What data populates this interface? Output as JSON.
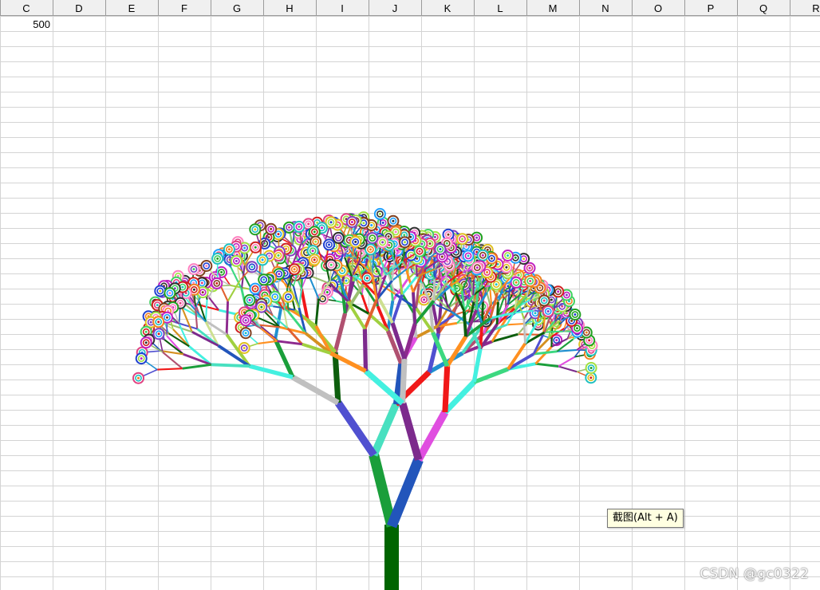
{
  "spreadsheet": {
    "column_headers": [
      "C",
      "D",
      "E",
      "F",
      "G",
      "H",
      "I",
      "J",
      "K",
      "L",
      "M",
      "N",
      "O",
      "P",
      "Q",
      "R"
    ],
    "cells": [
      {
        "column": "C",
        "row": 1,
        "value": "500"
      }
    ]
  },
  "tooltip": {
    "text": "截图(Alt + A)"
  },
  "watermark": {
    "text": "CSDN @gc0322"
  },
  "drawing": {
    "description_name": "fractal-tree",
    "trunk_color": "#006400",
    "branch_palette": [
      "#1a9e3a",
      "#8e2a8e",
      "#0d5e0d",
      "#e04ee0",
      "#b05070",
      "#cde090",
      "#44f0e0",
      "#2255bb",
      "#9bbf70",
      "#3cd880",
      "#c0c0c0",
      "#e06030",
      "#d59020",
      "#7c2a8c",
      "#48e0c0",
      "#f01818",
      "#2090d0",
      "#a0d040",
      "#ff9020",
      "#5050d0"
    ],
    "leaf_palette": [
      "#d02020",
      "#20a020",
      "#2040d0",
      "#e0c020",
      "#c020c0",
      "#20c0c0",
      "#804020",
      "#ff80c0",
      "#40d060",
      "#8040c0",
      "#f08020",
      "#20a0ff",
      "#303030",
      "#a0e040",
      "#e04080"
    ]
  }
}
